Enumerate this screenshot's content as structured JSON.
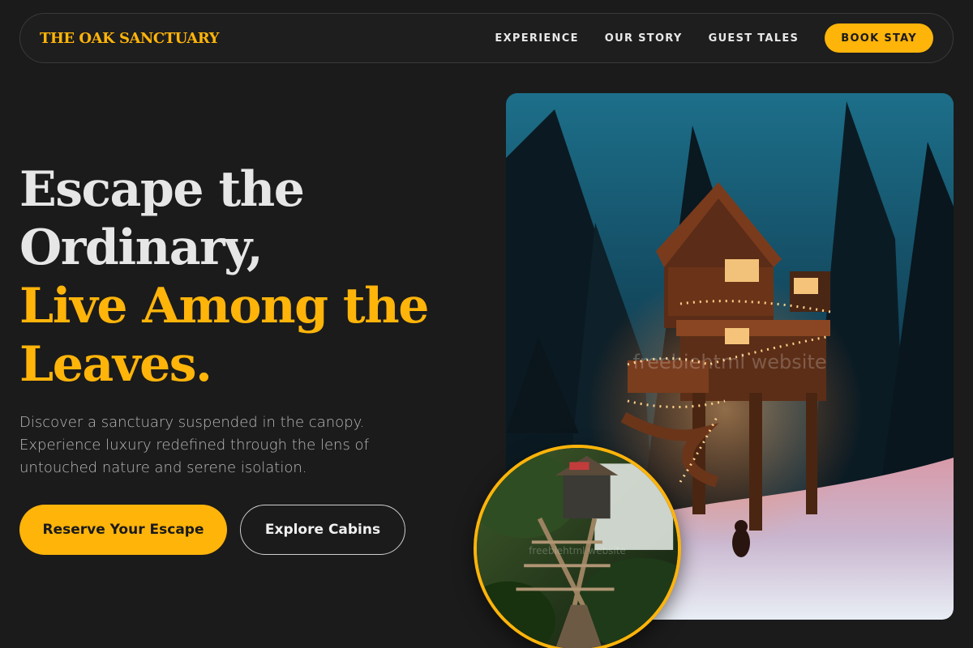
{
  "brand": {
    "logo": "THE OAK SANCTUARY"
  },
  "nav": {
    "links": [
      "EXPERIENCE",
      "OUR STORY",
      "GUEST TALES"
    ],
    "cta": "BOOK STAY"
  },
  "hero": {
    "headline_line1": "Escape the",
    "headline_line2": "Ordinary,",
    "headline_accent1": "Live Among the",
    "headline_accent2": "Leaves.",
    "lead_line1": "Discover a sanctuary suspended in the canopy.",
    "lead_line2": "Experience luxury redefined through the lens of",
    "lead_line3": "untouched nature and serene isolation.",
    "primary_button": "Reserve Your Escape",
    "secondary_button": "Explore Cabins"
  },
  "images": {
    "main_watermark": "freebiehtml website",
    "inset_watermark": "freebiehtml website"
  },
  "colors": {
    "accent": "#ffb40a",
    "background": "#1b1b1b",
    "text": "#e6e6e6",
    "muted": "#b9b9b9"
  }
}
